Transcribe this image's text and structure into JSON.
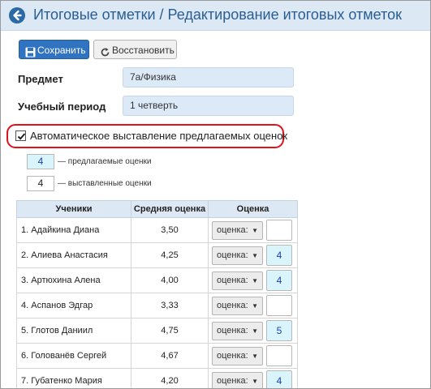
{
  "header": {
    "title": "Итоговые отметки / Редактирование итоговых отметок",
    "back_icon": "arrow-left-circle-icon"
  },
  "toolbar": {
    "save_label": "Сохранить",
    "restore_label": "Восстановить"
  },
  "form": {
    "subject_label": "Предмет",
    "subject_value": "7а/Физика",
    "period_label": "Учебный период",
    "period_value": "1 четверть",
    "auto_label": "Автоматическое выставление предлагаемых оценок",
    "auto_checked": true
  },
  "legend": {
    "suggested_value": "4",
    "suggested_label": "— предлагаемые оценки",
    "assigned_value": "4",
    "assigned_label": "— выставленные оценки"
  },
  "colors": {
    "header_bg": "#dce9f5",
    "accent": "#2f73c1",
    "suggested_bg": "#d9f4fb",
    "highlight": "#e0121b"
  },
  "table": {
    "headers": [
      "Ученики",
      "Средняя оценка",
      "Оценка"
    ],
    "select_placeholder": "оценка:",
    "rows": [
      {
        "name": "1. Адайкина Диана",
        "avg": "3,50",
        "grade": ""
      },
      {
        "name": "2. Алиева Анастасия",
        "avg": "4,25",
        "grade": "4"
      },
      {
        "name": "3. Артюхина Алена",
        "avg": "4,00",
        "grade": "4"
      },
      {
        "name": "4. Аспанов Эдгар",
        "avg": "3,33",
        "grade": ""
      },
      {
        "name": "5. Глотов Даниил",
        "avg": "4,75",
        "grade": "5"
      },
      {
        "name": "6. Голованёв Сергей",
        "avg": "4,67",
        "grade": ""
      },
      {
        "name": "7. Губатенко Мария",
        "avg": "4,20",
        "grade": "4"
      }
    ]
  }
}
